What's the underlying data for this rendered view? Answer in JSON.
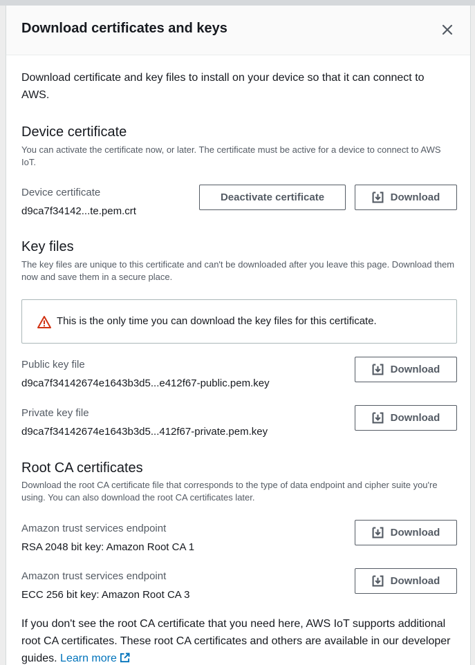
{
  "modal": {
    "title": "Download certificates and keys",
    "intro": "Download certificate and key files to install on your device so that it can connect to AWS."
  },
  "device_certificate": {
    "title": "Device certificate",
    "description": "You can activate the certificate now, or later. The certificate must be active for a device to connect to AWS IoT.",
    "label": "Device certificate",
    "filename": "d9ca7f34142...te.pem.crt",
    "deactivate_label": "Deactivate certificate",
    "download_label": "Download"
  },
  "key_files": {
    "title": "Key files",
    "description": "The key files are unique to this certificate and can't be downloaded after you leave this page. Download them now and save them in a secure place.",
    "alert": "This is the only time you can download the key files for this certificate.",
    "public": {
      "label": "Public key file",
      "filename": "d9ca7f34142674e1643b3d5...e412f67-public.pem.key",
      "download_label": "Download"
    },
    "private": {
      "label": "Private key file",
      "filename": "d9ca7f34142674e1643b3d5...412f67-private.pem.key",
      "download_label": "Download"
    }
  },
  "root_ca": {
    "title": "Root CA certificates",
    "description": "Download the root CA certificate file that corresponds to the type of data endpoint and cipher suite you're using. You can also download the root CA certificates later.",
    "items": [
      {
        "label": "Amazon trust services endpoint",
        "value": "RSA 2048 bit key: Amazon Root CA 1",
        "download_label": "Download"
      },
      {
        "label": "Amazon trust services endpoint",
        "value": "ECC 256 bit key: Amazon Root CA 3",
        "download_label": "Download"
      }
    ]
  },
  "footer": {
    "note": "If you don't see the root CA certificate that you need here, AWS IoT supports additional root CA certificates. These root CA certificates and others are available in our developer guides.",
    "link": "Learn more"
  },
  "icons": {
    "close": "close-icon",
    "download": "download-icon",
    "warning": "warning-icon",
    "external": "external-link-icon"
  },
  "colors": {
    "link": "#0073bb",
    "warning": "#d13212",
    "text": "#16191f",
    "secondary_text": "#545b64"
  }
}
